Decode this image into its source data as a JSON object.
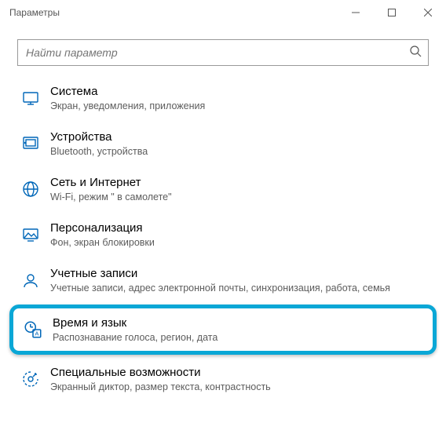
{
  "window": {
    "title": "Параметры"
  },
  "search": {
    "placeholder": "Найти параметр"
  },
  "items": [
    {
      "title": "Система",
      "subtitle": "Экран, уведомления, приложения"
    },
    {
      "title": "Устройства",
      "subtitle": "Bluetooth, устройства"
    },
    {
      "title": "Сеть и Интернет",
      "subtitle": "Wi-Fi, режим \" в самолете\""
    },
    {
      "title": "Персонализация",
      "subtitle": "Фон, экран блокировки"
    },
    {
      "title": "Учетные записи",
      "subtitle": "Учетные записи, адрес электронной почты, синхронизация, работа, семья"
    },
    {
      "title": "Время и язык",
      "subtitle": "Распознавание голоса, регион, дата"
    },
    {
      "title": "Специальные возможности",
      "subtitle": "Экранный диктор, размер текста, контрастность"
    }
  ]
}
